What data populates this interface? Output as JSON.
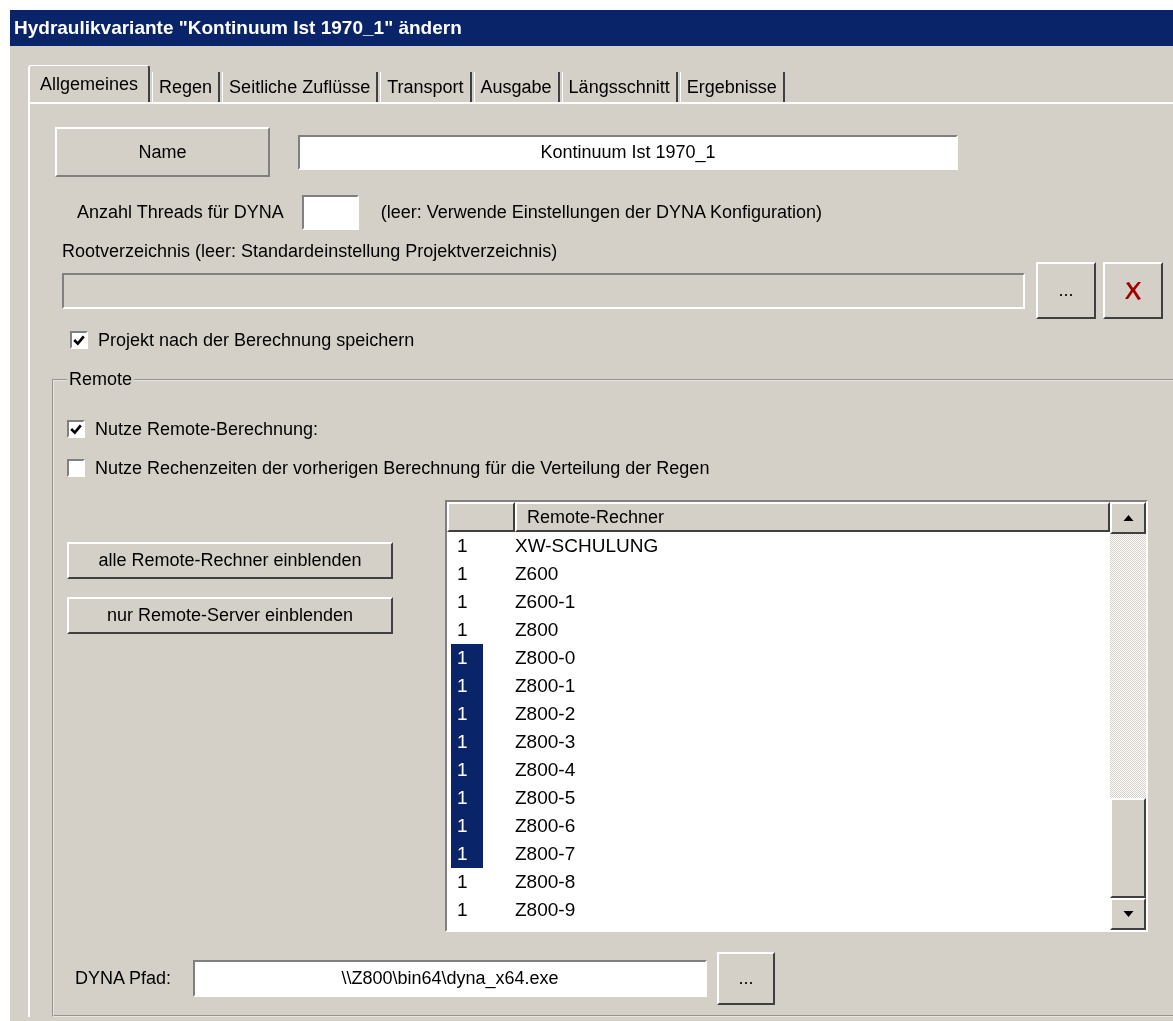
{
  "window": {
    "title": "Hydraulikvariante \"Kontinuum Ist 1970_1\" ändern"
  },
  "tabs": [
    {
      "label": "Allgemeines",
      "selected": true
    },
    {
      "label": "Regen",
      "selected": false
    },
    {
      "label": "Seitliche Zuflüsse",
      "selected": false
    },
    {
      "label": "Transport",
      "selected": false
    },
    {
      "label": "Ausgabe",
      "selected": false
    },
    {
      "label": "Längsschnitt",
      "selected": false
    },
    {
      "label": "Ergebnisse",
      "selected": false
    }
  ],
  "name": {
    "label": "Name",
    "value": "Kontinuum Ist 1970_1"
  },
  "threads": {
    "label": "Anzahl Threads für DYNA",
    "hint": "(leer: Verwende Einstellungen der DYNA Konfiguration)"
  },
  "root": {
    "label": "Rootverzeichnis (leer: Standardeinstellung Projektverzeichnis)",
    "browse_button": "..."
  },
  "save_after": {
    "label": "Projekt nach der Berechnung speichern",
    "checked": true
  },
  "remote": {
    "title": "Remote",
    "options": [
      {
        "label": "Nutze Remote-Berechnung:",
        "checked": true
      },
      {
        "label": "Nutze Rechenzeiten der vorherigen Berechnung für die Verteilung der Regen",
        "checked": false
      }
    ],
    "buttons": [
      "alle Remote-Rechner einblenden",
      "nur Remote-Server einblenden"
    ],
    "table": {
      "columns": [
        "Remote-Rechner"
      ],
      "rows": [
        {
          "count": "1",
          "name": "XW-SCHULUNG",
          "selected": false
        },
        {
          "count": "1",
          "name": "Z600",
          "selected": false
        },
        {
          "count": "1",
          "name": "Z600-1",
          "selected": false
        },
        {
          "count": "1",
          "name": "Z800",
          "selected": false
        },
        {
          "count": "1",
          "name": "Z800-0",
          "selected": true
        },
        {
          "count": "1",
          "name": "Z800-1",
          "selected": true
        },
        {
          "count": "1",
          "name": "Z800-2",
          "selected": true
        },
        {
          "count": "1",
          "name": "Z800-3",
          "selected": true
        },
        {
          "count": "1",
          "name": "Z800-4",
          "selected": true
        },
        {
          "count": "1",
          "name": "Z800-5",
          "selected": true
        },
        {
          "count": "1",
          "name": "Z800-6",
          "selected": true
        },
        {
          "count": "1",
          "name": "Z800-7",
          "selected": true
        },
        {
          "count": "1",
          "name": "Z800-8",
          "selected": false
        },
        {
          "count": "1",
          "name": "Z800-9",
          "selected": false
        }
      ]
    },
    "dyna_path": {
      "label": "DYNA Pfad:",
      "value": "\\\\Z800\\bin64\\dyna_x64.exe",
      "browse_button": "..."
    }
  }
}
